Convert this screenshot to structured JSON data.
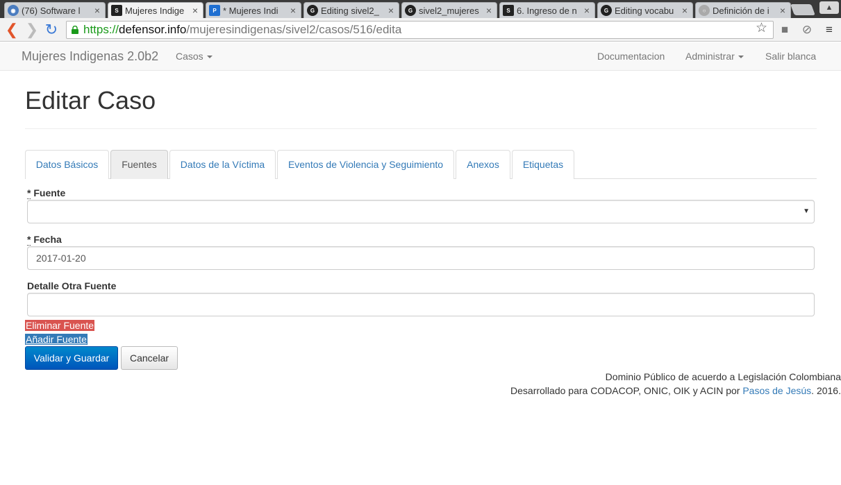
{
  "browser": {
    "tabs": [
      {
        "title": "(76) Software l",
        "icon": "globe-icon",
        "color": "#4a7cc0",
        "active": false
      },
      {
        "title": "Mujeres Indige",
        "icon": "sivel-icon",
        "color": "#222222",
        "active": true
      },
      {
        "title": "* Mujeres Indi",
        "icon": "pivotal-icon",
        "color": "#1f6fd1",
        "active": false
      },
      {
        "title": "Editing sivel2_",
        "icon": "github-icon",
        "color": "#222222",
        "active": false
      },
      {
        "title": "sivel2_mujeres",
        "icon": "github-icon",
        "color": "#222222",
        "active": false
      },
      {
        "title": "6. Ingreso de n",
        "icon": "sivel-icon",
        "color": "#222222",
        "active": false
      },
      {
        "title": "Editing vocabu",
        "icon": "github-icon",
        "color": "#222222",
        "active": false
      },
      {
        "title": "Definición de i",
        "icon": "page-icon",
        "color": "#aaaaaa",
        "active": false
      }
    ],
    "url_scheme": "https://",
    "url_host": "defensor.info",
    "url_path": "/mujeresindigenas/sivel2/casos/516/edita"
  },
  "navbar": {
    "brand": "Mujeres Indigenas 2.0b2",
    "casos": "Casos",
    "documentacion": "Documentacion",
    "administrar": "Administrar",
    "salir": "Salir blanca"
  },
  "page": {
    "title": "Editar Caso",
    "tabs": [
      {
        "label": "Datos Básicos"
      },
      {
        "label": "Fuentes"
      },
      {
        "label": "Datos de la Víctima"
      },
      {
        "label": "Eventos de Violencia y Seguimiento"
      },
      {
        "label": "Anexos"
      },
      {
        "label": "Etiquetas"
      }
    ],
    "fuente_label": "Fuente",
    "fuente_value": "",
    "fecha_label": "Fecha",
    "fecha_value": "2017-01-20",
    "detalle_label": "Detalle Otra Fuente",
    "detalle_value": "",
    "required_mark": "*",
    "eliminar": "Eliminar Fuente",
    "anadir": "Añadir Fuente",
    "guardar": "Validar y Guardar",
    "cancelar": "Cancelar"
  },
  "footer": {
    "line1": "Dominio Público de acuerdo a Legislación Colombiana",
    "line2_pre": "Desarrollado para CODACOP, ONIC, OIK y ACIN por ",
    "line2_link": "Pasos de Jesús",
    "line2_post": ". 2016."
  },
  "colors": {
    "primary": "#337ab7",
    "danger": "#d9534f",
    "url_green": "#1a9a1a"
  }
}
